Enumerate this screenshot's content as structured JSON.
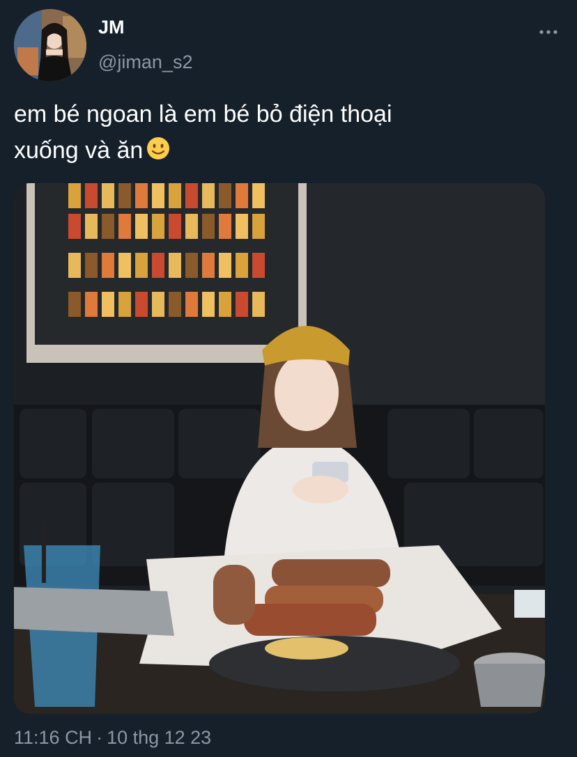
{
  "author": {
    "display_name": "JM",
    "handle": "@jiman_s2",
    "avatar_icon": "profile-photo"
  },
  "tweet": {
    "text_line1": "em bé ngoan là em bé bỏ điện thoại",
    "text_line2": "xuống và ăn",
    "emoji": "slightly-smiling-face"
  },
  "media": {
    "type": "photo"
  },
  "meta": {
    "time": "11:16 CH",
    "separator": "·",
    "date": "10 thg 12 23"
  },
  "colors": {
    "background": "#15202b",
    "secondary_text": "#8b98a5",
    "primary_text": "#ffffff"
  }
}
